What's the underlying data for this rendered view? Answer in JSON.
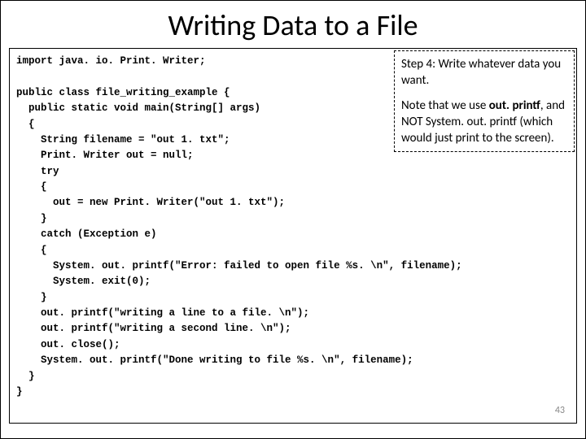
{
  "title": "Writing Data to a File",
  "code": {
    "l01": "import java. io. Print. Writer;",
    "l02": "",
    "l03": "public class file_writing_example {",
    "l04": "  public static void main(String[] args)",
    "l05": "  {",
    "l06": "    String filename = \"out 1. txt\";",
    "l07": "    Print. Writer out = null;",
    "l08": "    try",
    "l09": "    {",
    "l10": "      out = new Print. Writer(\"out 1. txt\");",
    "l11": "    }",
    "l12": "    catch (Exception e)",
    "l13": "    {",
    "l14": "      System. out. printf(\"Error: failed to open file %s. \\n\", filename);",
    "l15": "      System. exit(0);",
    "l16": "    }",
    "l17": "    out. printf(\"writing a line to a file. \\n\");",
    "l18": "    out. printf(\"writing a second line. \\n\");",
    "l19": "    out. close();",
    "l20": "    System. out. printf(\"Done writing to file %s. \\n\", filename);",
    "l21": "  }",
    "l22": "}"
  },
  "note": {
    "p1a": "Step 4: Write whatever data you want.",
    "p2a": "Note that we use ",
    "p2b": "out. printf",
    "p2c": ", and NOT System. out. printf (which would just print to the screen)."
  },
  "pagenum": "43"
}
